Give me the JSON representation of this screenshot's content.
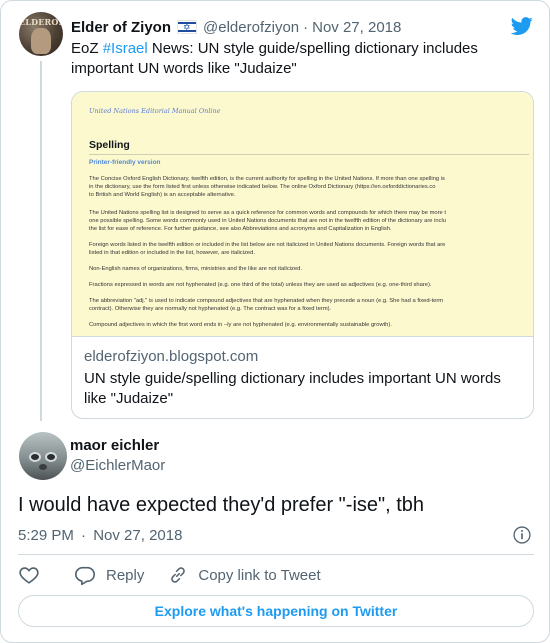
{
  "parent_tweet": {
    "author_name": "Elder of Ziyon",
    "flag_icon": "israel-flag-icon",
    "handle": "@elderofziyon",
    "separator": "·",
    "date": "Nov 27, 2018",
    "text_prefix": "EoZ ",
    "hashtag": "#Israel",
    "text_rest": " News: UN style guide/spelling dictionary includes important UN words like \"Judaize\"",
    "avatar_text": "ELDEROF",
    "link_card": {
      "image": {
        "manual_header": "United Nations Editorial Manual Online",
        "title": "Spelling",
        "printer_friendly": "Printer-friendly version",
        "paragraphs": [
          [
            "The Concise Oxford English Dictionary, twelfth edition, is the current authority for spelling in the United Nations. If more than one spelling is",
            "in the dictionary, use the form listed first unless otherwise indicated below. The online Oxford Dictionary (https://en.oxforddictionaries.co",
            "to British and World English) is an acceptable alternative."
          ],
          [
            "The United Nations spelling list is designed to serve as a quick reference for common words and compounds for which there may be more t",
            "one possible spelling. Some words commonly used in United Nations documents that are not in the twelfth edition of the dictionary are inclu",
            "the list for ease of reference. For further guidance, see also Abbreviations and acronyms and Capitalization in English."
          ],
          [
            "Foreign words listed in the twelfth edition or included in the list below are not italicized in United Nations documents. Foreign words that are",
            "listed in that edition or included in the list, however, are italicized."
          ],
          [
            "Non-English names of organizations, firms, ministries and the like are not italicized."
          ],
          [
            "Fractions expressed in words are not hyphenated (e.g. one third of the total) unless they are used as adjectives (e.g. one-third share)."
          ],
          [
            "The abbreviation \"adj.\" is used to indicate compound adjectives that are hyphenated when they precede a noun (e.g. She had a fixed-term",
            "contract). Otherwise they are normally not hyphenated (e.g. The contract was for a fixed term)."
          ],
          [
            "Compound adjectives in which the first word ends in –ly are not hyphenated (e.g. environmentally sustainable growth)."
          ]
        ]
      },
      "domain": "elderofziyon.blogspot.com",
      "title": "UN style guide/spelling dictionary includes important UN words like \"Judaize\""
    }
  },
  "tweet": {
    "author_name": "maor eichler",
    "handle": "@EichlerMaor",
    "text": "I would have expected they'd prefer \"-ise\", tbh",
    "time": "5:29 PM",
    "separator": "·",
    "date": "Nov 27, 2018"
  },
  "actions": {
    "like_icon": "heart-icon",
    "reply_label": "Reply",
    "reply_icon": "speech-bubble-icon",
    "copy_label": "Copy link to Tweet",
    "copy_icon": "link-icon"
  },
  "explore_button": {
    "label": "Explore what's happening on Twitter"
  },
  "colors": {
    "accent": "#1d9bf0",
    "text": "#0f1419",
    "secondary": "#536471",
    "border": "#cfd9de",
    "card_image_bg": "#fdf9cf"
  }
}
